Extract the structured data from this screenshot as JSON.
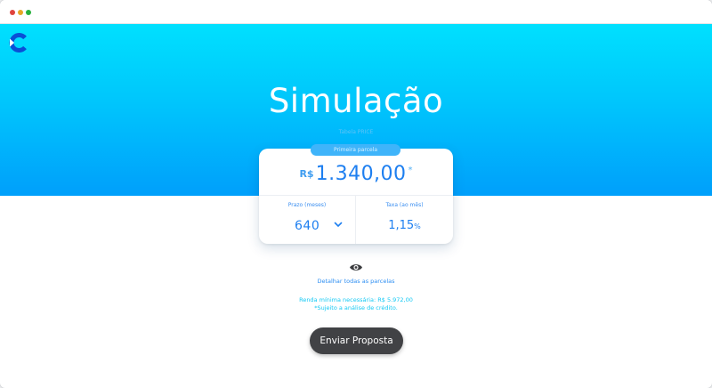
{
  "hero": {
    "title": "Simulação",
    "subtitle": "Tabela PRICE",
    "gradient_top": "#00e0fe",
    "gradient_bottom": "#009ffb",
    "logo_icon": "brand-c-logo-icon"
  },
  "summary": {
    "pill_label": "Primeira parcela",
    "currency": "R$",
    "amount": "1.340,00",
    "asterisk": "*"
  },
  "prazo": {
    "label": "Prazo (meses)",
    "value": "640",
    "dropdown_icon": "chevron-down-icon"
  },
  "taxa": {
    "label": "Taxa (ao mês)",
    "value": "1,15",
    "unit": "%"
  },
  "details": {
    "icon": "eye-icon",
    "link": "Detalhar todas as parcelas"
  },
  "notes": {
    "renda": "Renda mínima necessária: R$ 5.972,00",
    "sujeito": "*Sujeito a análise de crédito."
  },
  "actions": {
    "submit": "Enviar Proposta",
    "submit_color": "#414245"
  }
}
